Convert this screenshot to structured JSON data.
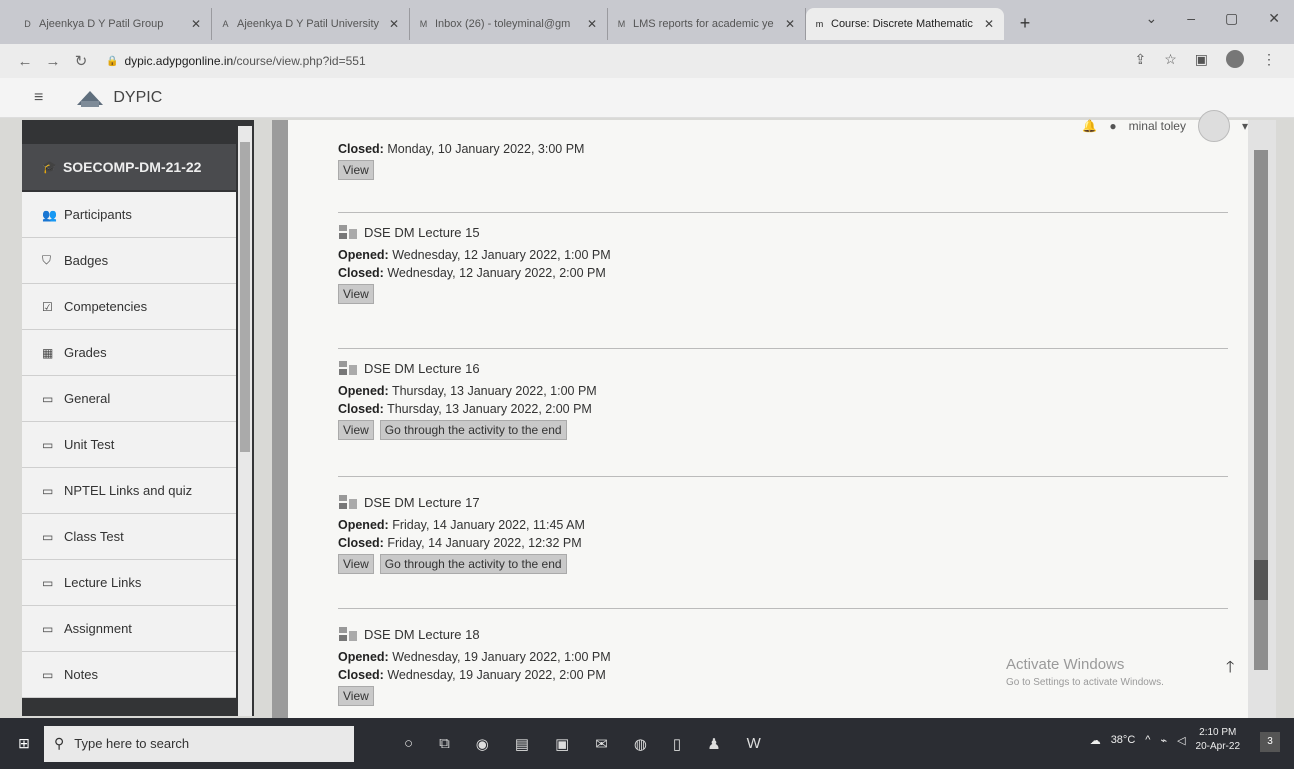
{
  "browser": {
    "tabs": [
      {
        "label": "Ajeenkya D Y Patil Group",
        "favicon": "D",
        "active": false
      },
      {
        "label": "Ajeenkya D Y Patil University",
        "favicon": "A",
        "active": false
      },
      {
        "label": "Inbox (26) - toleyminal@gm",
        "favicon": "M",
        "active": false
      },
      {
        "label": "LMS reports for academic ye",
        "favicon": "M",
        "active": false
      },
      {
        "label": "Course: Discrete Mathematic",
        "favicon": "m",
        "active": true
      }
    ],
    "url_host": "dypic.adypgonline.in",
    "url_path": "/course/view.php?id=551"
  },
  "moodle": {
    "brand": "DYPIC",
    "user_name": "minal toley"
  },
  "sidebar": {
    "course": "SOECOMP-DM-21-22",
    "items": [
      {
        "label": "Participants",
        "icon": "users-icon"
      },
      {
        "label": "Badges",
        "icon": "shield-icon"
      },
      {
        "label": "Competencies",
        "icon": "check-square-icon"
      },
      {
        "label": "Grades",
        "icon": "table-icon"
      },
      {
        "label": "General",
        "icon": "folder-icon"
      },
      {
        "label": "Unit Test",
        "icon": "folder-icon"
      },
      {
        "label": "NPTEL Links and quiz",
        "icon": "folder-icon"
      },
      {
        "label": "Class Test",
        "icon": "folder-icon"
      },
      {
        "label": "Lecture Links",
        "icon": "folder-icon"
      },
      {
        "label": "Assignment",
        "icon": "folder-icon"
      },
      {
        "label": "Notes",
        "icon": "folder-icon"
      }
    ]
  },
  "activities": [
    {
      "title": "",
      "opened": "",
      "closed": "Monday, 10 January 2022, 3:00 PM",
      "buttons": [
        "View"
      ]
    },
    {
      "title": "DSE DM Lecture 15",
      "opened": "Wednesday, 12 January 2022, 1:00 PM",
      "closed": "Wednesday, 12 January 2022, 2:00 PM",
      "buttons": [
        "View"
      ]
    },
    {
      "title": "DSE DM Lecture 16",
      "opened": "Thursday, 13 January 2022, 1:00 PM",
      "closed": "Thursday, 13 January 2022, 2:00 PM",
      "buttons": [
        "View",
        "Go through the activity to the end"
      ]
    },
    {
      "title": "DSE DM Lecture 17",
      "opened": "Friday, 14 January 2022, 11:45 AM",
      "closed": "Friday, 14 January 2022, 12:32 PM",
      "buttons": [
        "View",
        "Go through the activity to the end"
      ]
    },
    {
      "title": "DSE DM Lecture 18",
      "opened": "Wednesday, 19 January 2022, 1:00 PM",
      "closed": "Wednesday, 19 January 2022, 2:00 PM",
      "buttons": [
        "View"
      ]
    }
  ],
  "labels": {
    "opened": "Opened:",
    "closed": "Closed:"
  },
  "watermark": {
    "line1": "Activate Windows",
    "line2": "Go to Settings to activate Windows."
  },
  "taskbar": {
    "search_placeholder": "Type here to search",
    "temperature": "38°C",
    "time": "2:10 PM",
    "date": "20-Apr-22",
    "notifications": "3"
  }
}
